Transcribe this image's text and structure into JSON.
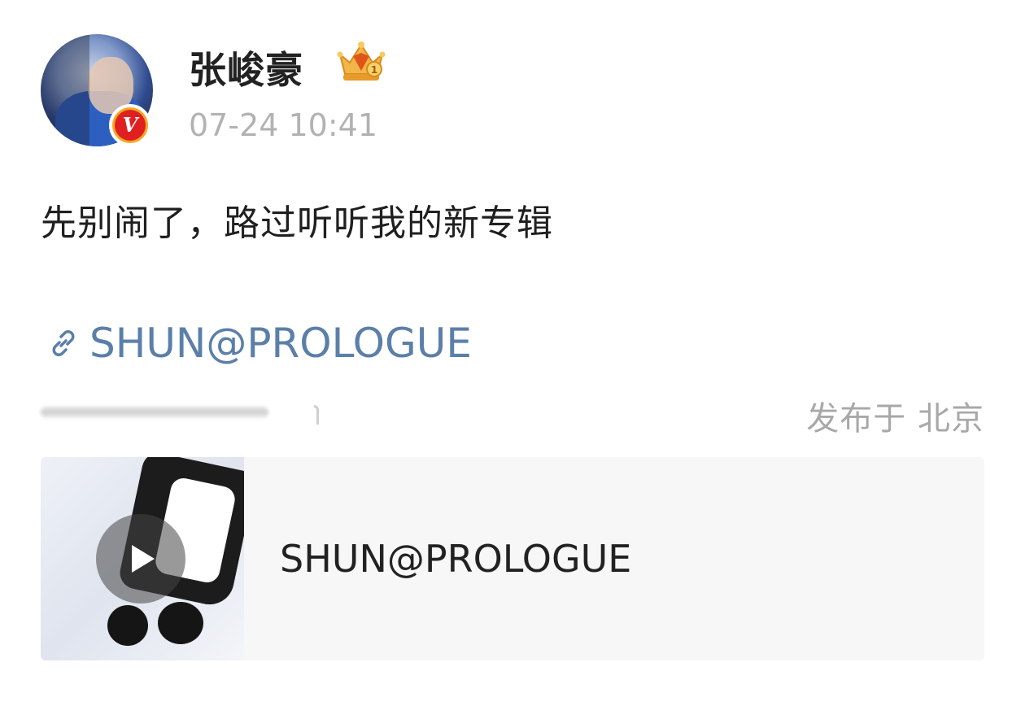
{
  "post": {
    "username": "张峻豪",
    "timestamp": "07-24 10:41",
    "verified_badge": "V",
    "text": "先别闹了，路过听听我的新专辑",
    "link_label": "SHUN@PROLOGUE",
    "location": "发布于 北京",
    "card_title": "SHUN@PROLOGUE"
  },
  "icons": {
    "crown": "crown-rank-icon",
    "link": "link-icon",
    "play": "play-icon",
    "verified": "verified-v-icon"
  },
  "colors": {
    "link": "#5b7fa8",
    "muted": "#b2b2b2",
    "verified_red": "#e02020",
    "verified_ring": "#f5a623",
    "card_bg": "#f7f7f7"
  }
}
